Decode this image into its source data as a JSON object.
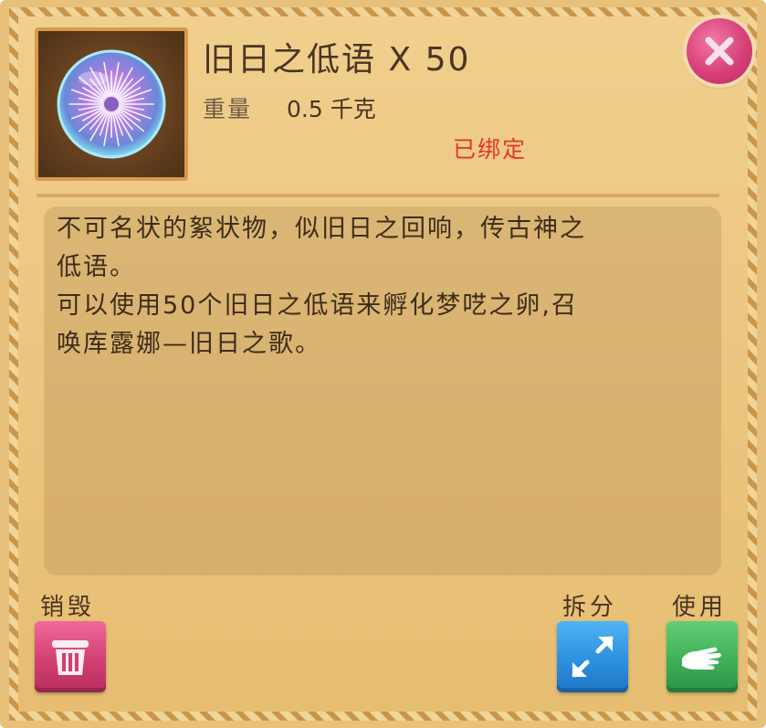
{
  "item": {
    "name": "旧日之低语",
    "quantity": "X 50",
    "weight_label": "重量",
    "weight_value": "0.5 千克",
    "bound_status": "已绑定",
    "icon": "spiky-orb-icon"
  },
  "description": {
    "lines": [
      "不可名状的絮状物，似旧日之回响，传古神之",
      "低语。",
      "可以使用50个旧日之低语来孵化梦呓之卵,召",
      "唤库露娜—旧日之歌。"
    ]
  },
  "actions": {
    "destroy_label": "销毁",
    "split_label": "拆分",
    "use_label": "使用"
  },
  "colors": {
    "panel_bg": "#e9c07a",
    "bound_text": "#e8342c",
    "destroy_button": "#d33f72",
    "split_button": "#2d90e0",
    "use_button": "#3fb059",
    "close_button": "#d84078"
  }
}
